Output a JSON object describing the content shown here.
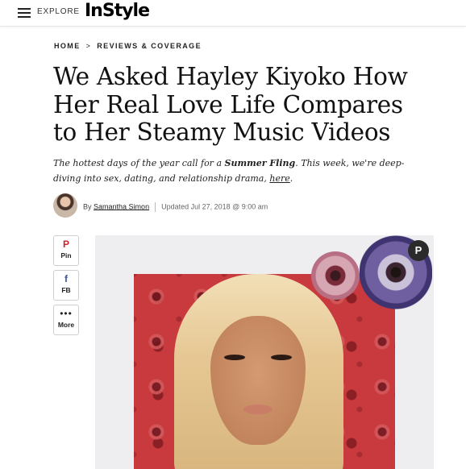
{
  "header": {
    "explore_label": "EXPLORE",
    "logo_text": "InStyle"
  },
  "breadcrumb": {
    "home": "HOME",
    "separator": ">",
    "section": "REVIEWS & COVERAGE"
  },
  "article": {
    "headline": "We Asked Hayley Kiyoko How Her Real Love Life Compares to Her Steamy Music Videos",
    "dek_part1": "The hottest days of the year call for a ",
    "dek_bold": "Summer Fling",
    "dek_part2": ". This week, we're deep-diving into sex, dating, and relationship drama, ",
    "dek_link": "here",
    "dek_end": "."
  },
  "byline": {
    "by": "By",
    "author": "Samantha Simon",
    "date": "Updated Jul 27, 2018 @ 9:00 am"
  },
  "share": {
    "pin": {
      "icon": "pinterest-icon",
      "glyph": "P",
      "label": "Pin"
    },
    "fb": {
      "icon": "facebook-icon",
      "glyph": "f",
      "label": "FB"
    },
    "more": {
      "icon": "more-dots-icon",
      "glyph": "•••",
      "label": "More"
    }
  },
  "hero": {
    "pin_glyph": "P"
  },
  "colors": {
    "pinterest": "#c8232c",
    "facebook": "#3b5998",
    "text": "#111111"
  }
}
